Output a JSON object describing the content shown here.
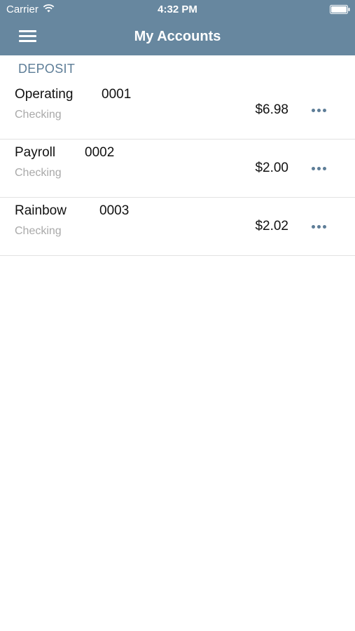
{
  "status_bar": {
    "carrier": "Carrier",
    "time": "4:32 PM",
    "wifi_icon": "wifi-icon",
    "battery_icon": "battery-full-icon"
  },
  "nav": {
    "title": "My Accounts",
    "menu_icon": "hamburger-menu-icon"
  },
  "section": {
    "title": "DEPOSIT"
  },
  "accounts": [
    {
      "name": "Operating",
      "number": "0001",
      "type": "Checking",
      "balance": "$6.98",
      "more_icon": "more-options-icon"
    },
    {
      "name": "Payroll",
      "number": "0002",
      "type": "Checking",
      "balance": "$2.00",
      "more_icon": "more-options-icon"
    },
    {
      "name": "Rainbow",
      "number": "0003",
      "type": "Checking",
      "balance": "$2.02",
      "more_icon": "more-options-icon"
    }
  ],
  "colors": {
    "header_background": "#67879f",
    "accent": "#5d7d97",
    "secondary_text": "#a9a9a9",
    "divider": "#e2e2e2"
  }
}
